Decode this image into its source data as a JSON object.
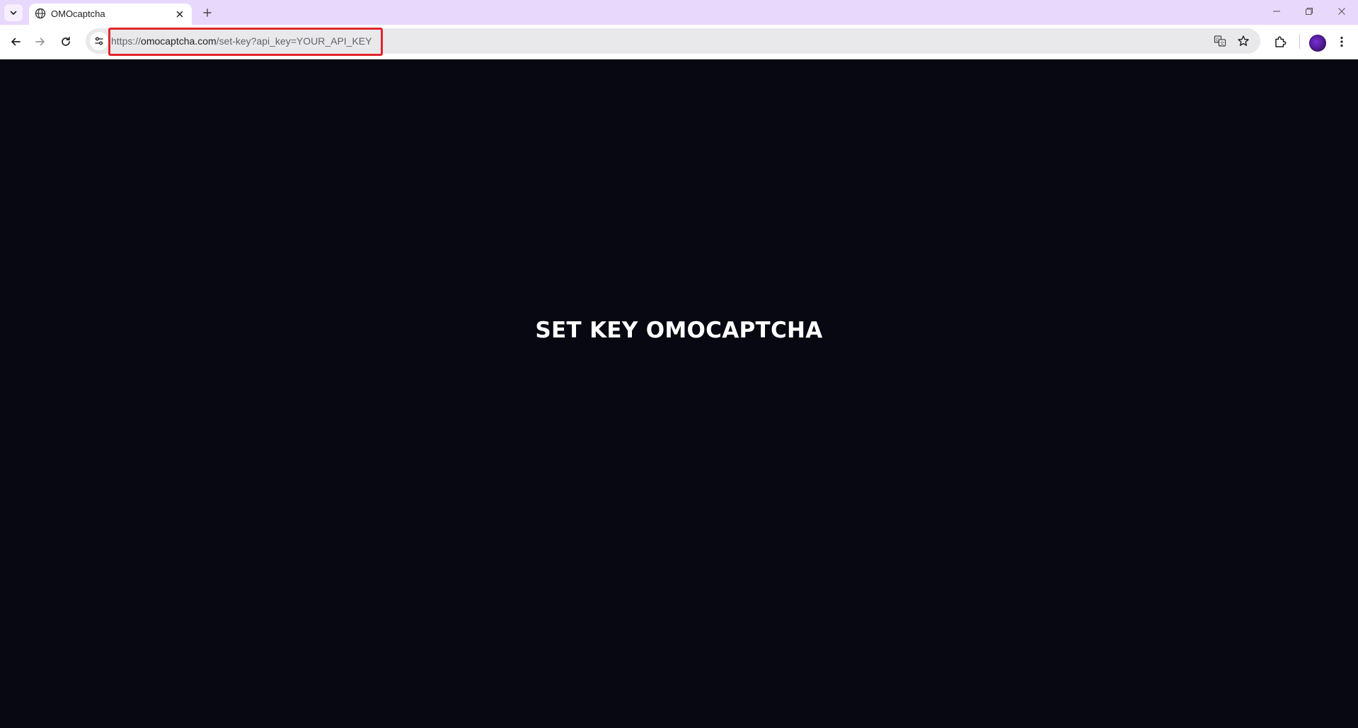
{
  "browser": {
    "tab": {
      "title": "OMOcaptcha"
    },
    "address_bar": {
      "url_scheme": "https://",
      "url_host": "omocaptcha.com",
      "url_path": "/set-key?api_key=YOUR_API_KEY",
      "highlight_color": "#e0262b"
    },
    "icons": {
      "tab_search": "chevron-down-icon",
      "favicon": "globe-icon",
      "close_tab": "close-icon",
      "new_tab": "plus-icon",
      "back": "arrow-left-icon",
      "forward": "arrow-right-icon",
      "reload": "reload-icon",
      "site_info": "tune-icon",
      "translate": "translate-icon",
      "bookmark": "star-icon",
      "extensions": "puzzle-icon",
      "menu": "kebab-menu-icon"
    },
    "colors": {
      "tab_strip": "#e8d8fb",
      "page_background": "#070812",
      "heading_text": "#ffffff"
    }
  },
  "page": {
    "heading": "SET KEY OMOCAPTCHA"
  }
}
